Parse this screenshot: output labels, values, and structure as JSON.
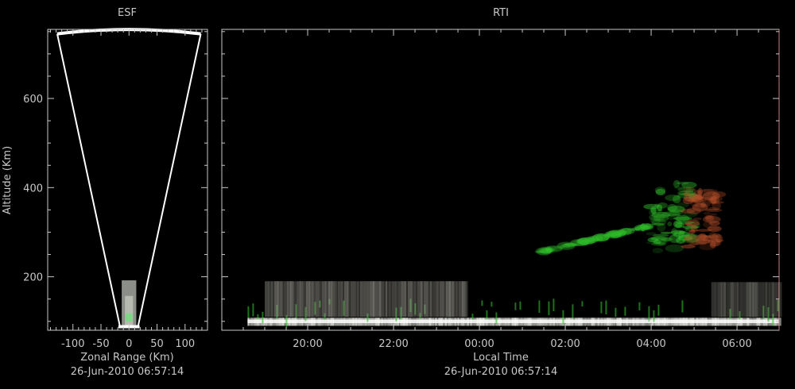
{
  "chart_data": [
    {
      "type": "radar-fan",
      "title": "ESF",
      "xlabel": "Zonal Range (Km)",
      "ylabel": "Altitude (Km)",
      "caption": "26-Jun-2010 06:57:14",
      "xlim": [
        -145,
        140
      ],
      "ylim": [
        80,
        755
      ],
      "x_ticks": [
        -100,
        -50,
        0,
        50,
        100
      ],
      "x_tick_labels": [
        "-100",
        "-50",
        "0",
        "50",
        "100"
      ],
      "y_ticks": [
        200,
        400,
        600
      ],
      "y_tick_labels": [
        "200",
        "400",
        "600"
      ],
      "fan": {
        "apex_altitude": 88,
        "edge_altitude": 745,
        "left_zonal": -128,
        "right_zonal": 128,
        "inner_left_zonal": -16,
        "inner_right_zonal": 16
      },
      "echo": {
        "altitude_min": 88,
        "altitude_max": 192,
        "zonal_min": -13,
        "zonal_max": 13
      },
      "colors": {
        "axis": "#c8c8c8",
        "fan": "#ffffff"
      }
    },
    {
      "type": "heatmap",
      "title": "RTI",
      "xlabel": "Local Time",
      "caption": "26-Jun-2010 06:57:14",
      "x_ticks": [
        20,
        22,
        24,
        26,
        28,
        30
      ],
      "x_tick_labels": [
        "20:00",
        "22:00",
        "00:00",
        "02:00",
        "04:00",
        "06:00"
      ],
      "xlim": [
        18.0,
        30.98
      ],
      "ylim": [
        80,
        755
      ],
      "y_ticks": [
        200,
        400,
        600
      ],
      "colors": {
        "axis": "#c8c8c8",
        "white_echo": "#e8e8e2",
        "green_echo": "#2fbf2a",
        "red_echo": "#b8502a"
      },
      "features": [
        {
          "name": "bottomside-echo",
          "color": "white",
          "time_start": 18.6,
          "time_end": 31.0,
          "alt_min": 90,
          "alt_max": 108,
          "intensity": 0.95
        },
        {
          "name": "layer-echo",
          "color": "gray",
          "time_start": 19.0,
          "time_end": 23.7,
          "alt_min": 110,
          "alt_max": 190,
          "intensity": 0.55
        },
        {
          "name": "layer-echo-late",
          "color": "gray",
          "time_start": 29.4,
          "time_end": 31.0,
          "alt_min": 110,
          "alt_max": 188,
          "intensity": 0.45
        },
        {
          "name": "plume-rising",
          "color": "green",
          "time_start": 25.4,
          "time_end": 28.0,
          "alt_min": 255,
          "alt_max": 330,
          "intensity": 0.7
        },
        {
          "name": "plume-main",
          "color": "green",
          "time_start": 28.0,
          "time_end": 29.0,
          "alt_min": 255,
          "alt_max": 410,
          "intensity": 0.75
        },
        {
          "name": "plume-red",
          "color": "red",
          "time_start": 28.8,
          "time_end": 29.6,
          "alt_min": 265,
          "alt_max": 400,
          "intensity": 0.7
        }
      ]
    }
  ]
}
